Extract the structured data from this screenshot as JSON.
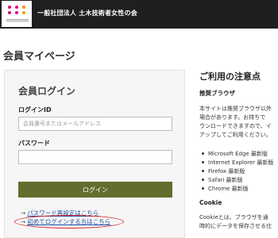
{
  "header": {
    "org_name": "一般社団法人 土木技術者女性の会",
    "logo_dot_colors": [
      "#e6007e",
      "#e6007e",
      "#f39800",
      "#e6007e",
      "#e6007e",
      "#f39800"
    ]
  },
  "page_title": "会員マイページ",
  "login": {
    "title": "会員ログイン",
    "id_label": "ログインID",
    "id_placeholder": "会員番号またはメールアドレス",
    "id_value": "",
    "password_label": "パスワード",
    "password_value": "",
    "button_label": "ログイン",
    "links": [
      {
        "arrow": "→",
        "label": "パスワード再設定はこちら"
      },
      {
        "arrow": "→",
        "label": "初めてログインする方はこちら"
      }
    ],
    "highlight_color": "#d6262a"
  },
  "notes": {
    "heading": "ご利用の注意点",
    "browser_heading": "推奨ブラウザ",
    "browser_text": [
      "本サイトは推奨ブラウザ以外",
      "場合があります。お持ちで",
      "ウンロードできますので、イ",
      "アップしてご利用ください。"
    ],
    "browsers": [
      "Microsoft Edge 最新版",
      "Internet Explorer 最新版",
      "Firefox 最新版",
      "Safari 最新版",
      "Chrome 最新版"
    ],
    "cookie_heading": "Cookie",
    "cookie_text": [
      "Cookieとは、ブラウザを通",
      "時的にデータを保存させる仕"
    ]
  },
  "colors": {
    "header_bg": "#1f1f1f",
    "button_bg": "#646d2e",
    "link": "#1a4fa3"
  }
}
